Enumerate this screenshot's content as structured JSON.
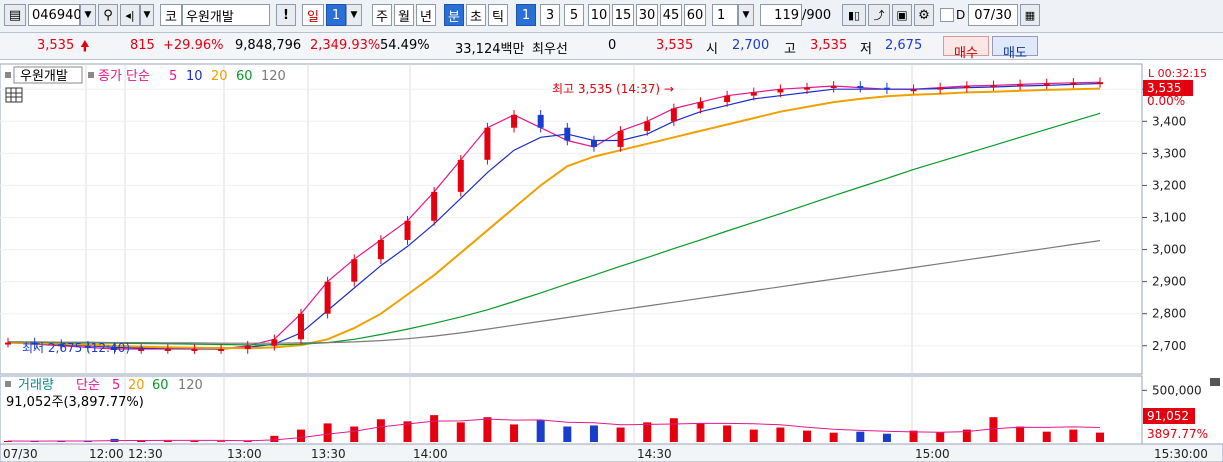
{
  "toolbar": {
    "code": "046940",
    "market_badge": "코",
    "stock_name": "우원개발",
    "excl": "!",
    "period_day": "일",
    "period_num": "1",
    "btn_week": "주",
    "btn_month": "월",
    "btn_year": "년",
    "btn_minute": "분",
    "btn_second": "초",
    "btn_tick": "틱",
    "intervals": [
      "1",
      "3",
      "5",
      "10",
      "15",
      "30",
      "45",
      "60"
    ],
    "sel_interval": "1",
    "count": "119",
    "count_total": "/900",
    "date_flag": "D",
    "date": "07/30"
  },
  "info": {
    "price": "3,535",
    "change": "815",
    "change_pct": "+29.96%",
    "volume": "9,848,796",
    "vol_ratio": "2,349.93%",
    "turnover": "54.49%",
    "amount": "33,124백만",
    "priority_label": "최우선",
    "priority_value": "0",
    "cur": "3,535",
    "open_label": "시",
    "open": "2,700",
    "high_label": "고",
    "high": "3,535",
    "low_label": "저",
    "low": "2,675",
    "buy_label": "매수",
    "sell_label": "매도"
  },
  "price_legend": {
    "name": "우원개발",
    "kind": "종가 단순",
    "ma": [
      "5",
      "10",
      "20",
      "60",
      "120"
    ]
  },
  "volume_legend": {
    "name": "거래량",
    "kind": "단순",
    "ma": [
      "5",
      "20",
      "60",
      "120"
    ],
    "value": "91,052주(3,897.77%)"
  },
  "annotations": {
    "high_marker": "최고 3,535 (14:37) →",
    "low_marker": "최저 2,675 (12:40) →",
    "pct_tag": "0.00%",
    "price_tag": "3,535",
    "clock_tag": "L 00:32:15",
    "vol_tag_value": "91,052",
    "vol_tag_pct": "3897.77%"
  },
  "colors": {
    "up": "#e4000f",
    "down": "#1b3dce",
    "ma5": "#e0198e",
    "ma10": "#1b2fc8",
    "ma20": "#f0a000",
    "ma60": "#0a9a2a",
    "ma120": "#7a7a7a",
    "accent": "#2a6fd6"
  },
  "chart_data": [
    {
      "type": "line",
      "title": "우원개발 1분",
      "x_ticks": [
        "07/30",
        "12:00",
        "12:30",
        "13:00",
        "13:30",
        "14:00",
        "14:30",
        "15:00",
        "15:30:00"
      ],
      "y_ticks": [
        2700,
        2800,
        2900,
        3000,
        3100,
        3200,
        3300,
        3400,
        3500
      ],
      "ylim": [
        2640,
        3560
      ],
      "series": [
        {
          "name": "5",
          "values": [
            2710,
            2705,
            2700,
            2695,
            2690,
            2690,
            2690,
            2690,
            2690,
            2700,
            2720,
            2800,
            2900,
            2970,
            3030,
            3090,
            3180,
            3280,
            3380,
            3420,
            3380,
            3340,
            3320,
            3370,
            3400,
            3440,
            3460,
            3480,
            3490,
            3500,
            3505,
            3510,
            3505,
            3500,
            3500,
            3505,
            3510,
            3512,
            3515,
            3518,
            3520,
            3522
          ]
        },
        {
          "name": "10",
          "values": [
            2710,
            2707,
            2703,
            2700,
            2695,
            2693,
            2692,
            2691,
            2690,
            2695,
            2705,
            2740,
            2810,
            2880,
            2950,
            3010,
            3080,
            3160,
            3240,
            3310,
            3350,
            3360,
            3340,
            3340,
            3360,
            3400,
            3430,
            3450,
            3470,
            3480,
            3490,
            3500,
            3500,
            3500,
            3500,
            3502,
            3505,
            3507,
            3510,
            3512,
            3515,
            3518
          ]
        },
        {
          "name": "20",
          "values": [
            2710,
            2708,
            2706,
            2703,
            2700,
            2697,
            2695,
            2694,
            2693,
            2692,
            2695,
            2702,
            2720,
            2755,
            2800,
            2860,
            2920,
            2990,
            3060,
            3130,
            3200,
            3260,
            3290,
            3310,
            3330,
            3350,
            3370,
            3390,
            3410,
            3430,
            3445,
            3460,
            3470,
            3478,
            3483,
            3486,
            3490,
            3492,
            3495,
            3498,
            3500,
            3502
          ]
        },
        {
          "name": "60",
          "values": [
            2712,
            2711,
            2710,
            2709,
            2708,
            2707,
            2706,
            2705,
            2704,
            2703,
            2703,
            2705,
            2710,
            2720,
            2735,
            2752,
            2770,
            2790,
            2812,
            2838,
            2865,
            2893,
            2920,
            2948,
            2975,
            3003,
            3030,
            3058,
            3085,
            3112,
            3140,
            3168,
            3195,
            3222,
            3250,
            3275,
            3300,
            3325,
            3350,
            3375,
            3400,
            3425
          ]
        },
        {
          "name": "120",
          "values": [
            2712,
            2712,
            2711,
            2711,
            2710,
            2710,
            2709,
            2709,
            2708,
            2708,
            2708,
            2709,
            2710,
            2712,
            2716,
            2722,
            2730,
            2740,
            2752,
            2764,
            2776,
            2788,
            2800,
            2812,
            2824,
            2836,
            2848,
            2860,
            2872,
            2884,
            2896,
            2908,
            2920,
            2932,
            2944,
            2956,
            2968,
            2980,
            2992,
            3004,
            3016,
            3028
          ]
        }
      ]
    },
    {
      "type": "bar",
      "title": "거래량",
      "y_ticks": [
        500000
      ],
      "ylim": [
        0,
        600000
      ],
      "series": [
        {
          "name": "거래량",
          "values": [
            10000,
            8000,
            12000,
            9000,
            30000,
            15000,
            12000,
            10000,
            8000,
            14000,
            60000,
            120000,
            180000,
            150000,
            220000,
            200000,
            260000,
            190000,
            240000,
            170000,
            210000,
            150000,
            160000,
            140000,
            190000,
            230000,
            180000,
            160000,
            120000,
            140000,
            110000,
            90000,
            100000,
            80000,
            110000,
            95000,
            120000,
            240000,
            150000,
            100000,
            120000,
            91052
          ]
        }
      ]
    }
  ]
}
